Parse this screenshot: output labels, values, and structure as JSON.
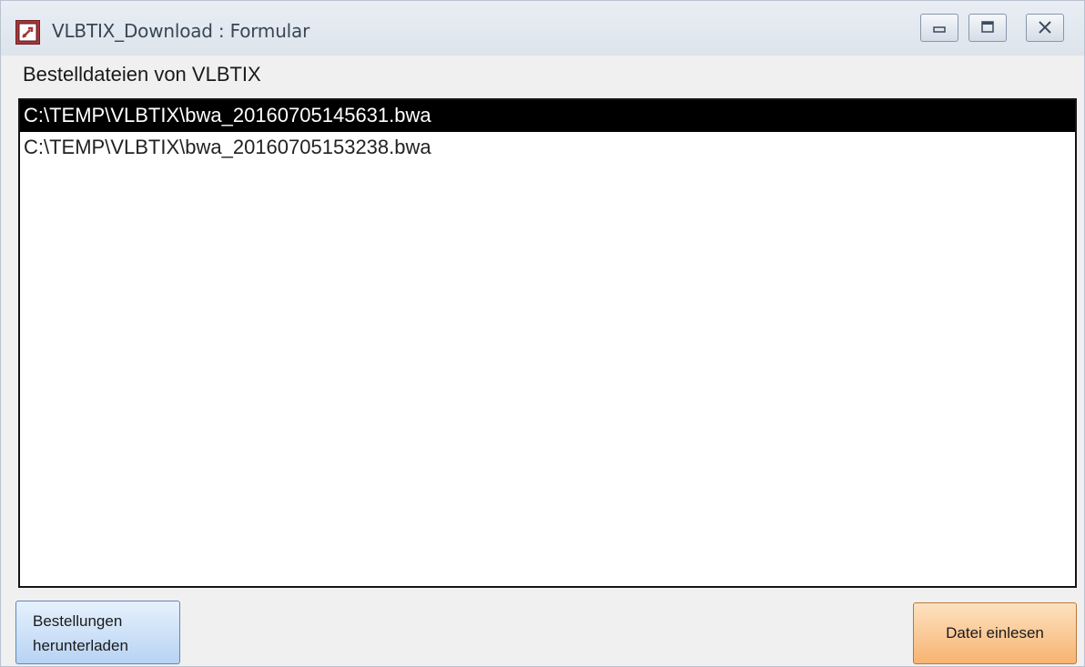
{
  "window": {
    "title": "VLBTIX_Download : Formular",
    "icon": "access-form-icon",
    "controls": [
      "minimize-icon",
      "maximize-icon",
      "close-icon"
    ]
  },
  "list": {
    "label": "Bestelldateien von VLBTIX",
    "items": [
      {
        "path": "C:\\TEMP\\VLBTIX\\bwa_20160705145631.bwa",
        "selected": true
      },
      {
        "path": "C:\\TEMP\\VLBTIX\\bwa_20160705153238.bwa",
        "selected": false
      }
    ]
  },
  "buttons": {
    "download_line1": "Bestellungen",
    "download_line2": "herunterladen",
    "read_file": "Datei einlesen"
  },
  "colors": {
    "selection": "#000000",
    "download_button": "#b7d3f3",
    "read_button": "#f7b472"
  }
}
